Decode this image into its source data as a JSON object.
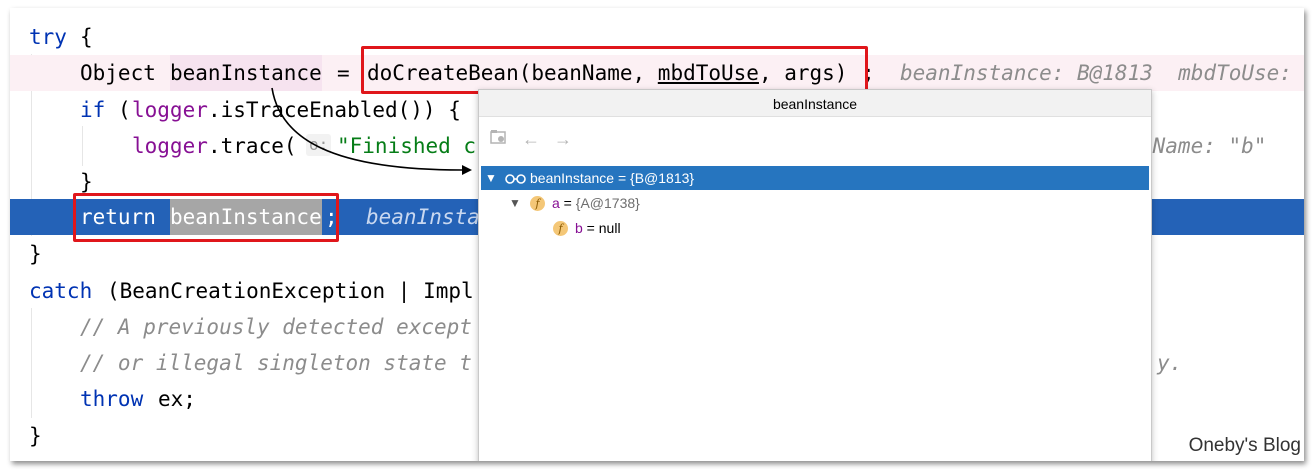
{
  "code": {
    "l1_try": "try",
    "l1_brace": "{",
    "l2_type": "Object",
    "l2_var": "beanInstance",
    "l2_eq": "=",
    "l2_call": "doCreateBean(beanName, ",
    "l2_arg2": "mbdToUse",
    "l2_rest": ", args)",
    "l2_semi": ";",
    "l2_hint": "beanInstance: B@1813  mbdToUse:",
    "l3_if": "if",
    "l3_open": "(",
    "l3_logger": "logger",
    "l3_rest": ".isTraceEnabled()) {",
    "l4_logger": "logger",
    "l4_trace": ".trace(",
    "l4_param": "o:",
    "l4_str": "\"Finished c",
    "l4_hint": "nName: \"b\"",
    "l5_close": "}",
    "l6_return": "return",
    "l6_var": "beanInstance",
    "l6_semi": ";",
    "l6_hint": "beanInsta",
    "l7_close": "}",
    "l8_catch": "catch",
    "l8_rest": "(BeanCreationException | Impl",
    "l9_comment": "// A previously detected except",
    "l10_comment": "// or illegal singleton state t",
    "l10_tail": "y.",
    "l11_throw": "throw",
    "l11_rest": "ex;",
    "l12_close": "}"
  },
  "popup": {
    "title": "beanInstance",
    "toolbar": {
      "icon1": "screenshot-icon",
      "back": "←",
      "forward": "→"
    },
    "tree": [
      {
        "name": "beanInstance",
        "op": " = ",
        "value": "{B@1813}"
      },
      {
        "badge": "f",
        "name": "a",
        "op": " = ",
        "value": "{A@1738}"
      },
      {
        "badge": "f",
        "name": "b",
        "op": " = ",
        "value": "null"
      }
    ]
  },
  "watermark": "Oneby's Blog",
  "colors": {
    "keyword": "#0033b3",
    "field": "#871094",
    "string": "#067d17",
    "execution_line": "#2462b7",
    "highlight_box": "#e0161b"
  }
}
